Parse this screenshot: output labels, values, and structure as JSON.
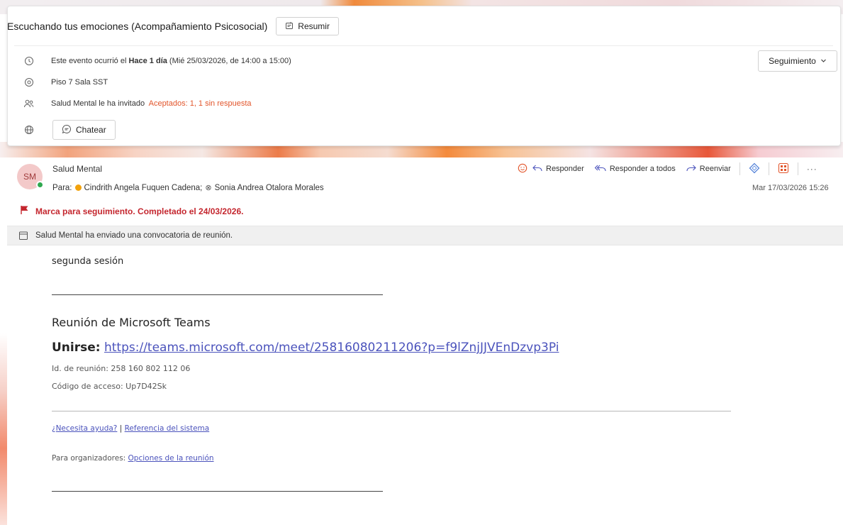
{
  "meeting": {
    "title": "Escuchando tus emociones (Acompañamiento Psicosocial)",
    "summarize_label": "Resumir",
    "when_prefix": "Este evento ocurrió el ",
    "when_bold": "Hace 1 día",
    "when_suffix": " (Mié 25/03/2026, de 14:00 a 15:00)",
    "location": "Piso 7 Sala SST",
    "invited_by": "Salud Mental le ha invitado",
    "attendance": "Aceptados: 1, 1 sin respuesta",
    "chat_label": "Chatear",
    "followup_label": "Seguimiento"
  },
  "message": {
    "avatar_initials": "SM",
    "sender": "Salud Mental",
    "to_label": "Para:",
    "recipient_1": "Cindrith Angela Fuquen Cadena;",
    "recipient_2": "Sonia Andrea Otalora Morales",
    "date": "Mar 17/03/2026 15:26",
    "actions": {
      "reply": "Responder",
      "reply_all": "Responder a todos",
      "forward": "Reenviar"
    },
    "flag_text": "Marca para seguimiento. Completado el 24/03/2026.",
    "meeting_notice": "Salud Mental ha enviado una convocatoria de reunión."
  },
  "body": {
    "intro": "segunda sesión",
    "teams_heading": "Reunión de Microsoft Teams",
    "join_label": "Unirse:",
    "join_url": "https://teams.microsoft.com/meet/25816080211206?p=f9lZnjJJVEnDzvp3Pi",
    "meeting_id": "Id. de reunión: 258 160 802 112 06",
    "passcode": "Código de acceso: Up7D42Sk",
    "help_link": "¿Necesita ayuda?",
    "pipe": "|",
    "system_ref_link": "Referencia del sistema",
    "organizers_prefix": "Para organizadores:",
    "options_link": "Opciones de la reunión"
  },
  "colors": {
    "accent_link": "#4b53bc",
    "attendance_orange": "#e2552b",
    "flag_red": "#c4262e",
    "presence_green": "#2fa84f"
  }
}
